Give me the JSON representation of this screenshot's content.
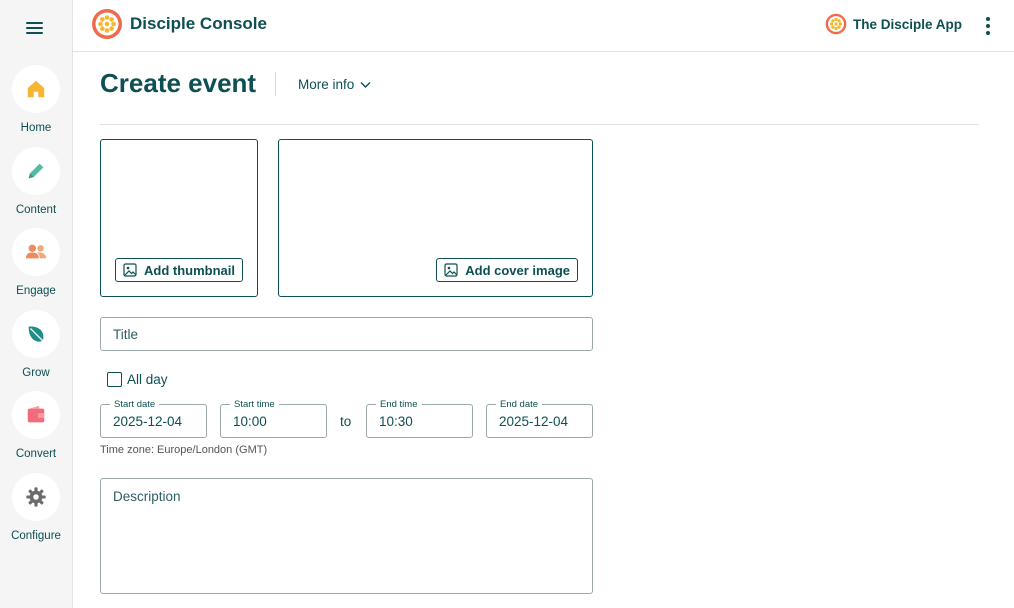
{
  "header": {
    "brand_title": "Disciple Console",
    "app_name": "The Disciple App"
  },
  "sidebar": {
    "items": [
      {
        "label": "Home",
        "icon": "home-icon",
        "color": "#f5b731"
      },
      {
        "label": "Content",
        "icon": "pencil-icon",
        "color": "#4dbfa8"
      },
      {
        "label": "Engage",
        "icon": "people-icon",
        "color": "#f08a5d"
      },
      {
        "label": "Grow",
        "icon": "leaf-icon",
        "color": "#1b8f86"
      },
      {
        "label": "Convert",
        "icon": "wallet-icon",
        "color": "#f26b7a"
      },
      {
        "label": "Configure",
        "icon": "gear-icon",
        "color": "#6b6b6b"
      }
    ]
  },
  "page": {
    "title": "Create event",
    "more_info": "More info"
  },
  "images": {
    "thumbnail_label": "Add thumbnail",
    "cover_label": "Add cover image"
  },
  "form": {
    "title_placeholder": "Title",
    "all_day_label": "All day",
    "start_date_label": "Start date",
    "start_date": "2025-12-04",
    "start_time_label": "Start time",
    "start_time": "10:00",
    "to_label": "to",
    "end_time_label": "End time",
    "end_time": "10:30",
    "end_date_label": "End date",
    "end_date": "2025-12-04",
    "timezone": "Time zone: Europe/London (GMT)",
    "description_placeholder": "Description"
  },
  "colors": {
    "primary": "#0d4f52",
    "brand_orange": "#f06a4d",
    "brand_yellow": "#f5b731"
  }
}
